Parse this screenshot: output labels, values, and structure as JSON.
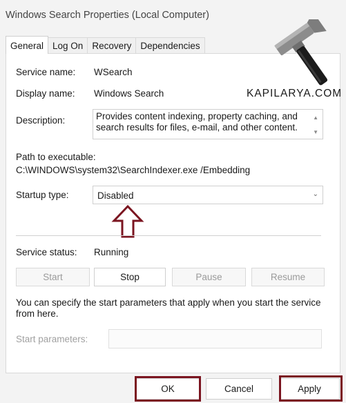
{
  "window": {
    "title": "Windows Search Properties (Local Computer)"
  },
  "tabs": [
    {
      "label": "General",
      "active": true
    },
    {
      "label": "Log On"
    },
    {
      "label": "Recovery"
    },
    {
      "label": "Dependencies"
    }
  ],
  "general": {
    "service_name_label": "Service name:",
    "service_name_value": "WSearch",
    "display_name_label": "Display name:",
    "display_name_value": "Windows Search",
    "description_label": "Description:",
    "description_line1": "Provides content indexing, property caching, and",
    "description_line2": "search results for files, e-mail, and other content.",
    "path_label": "Path to executable:",
    "path_value": "C:\\WINDOWS\\system32\\SearchIndexer.exe /Embedding",
    "startup_label": "Startup type:",
    "startup_value": "Disabled",
    "status_label": "Service status:",
    "status_value": "Running",
    "buttons": {
      "start": "Start",
      "stop": "Stop",
      "pause": "Pause",
      "resume": "Resume"
    },
    "info_line1": "You can specify the start parameters that apply when you start the service",
    "info_line2": "from here.",
    "start_params_label": "Start parameters:",
    "start_params_value": ""
  },
  "footer": {
    "ok": "OK",
    "cancel": "Cancel",
    "apply": "Apply"
  },
  "watermark": {
    "text": "KAPILARYA.COM",
    "icon": "hammer-icon"
  },
  "annotation": {
    "arrow_icon": "up-arrow-outline-icon",
    "highlight_color": "#7b1520"
  }
}
